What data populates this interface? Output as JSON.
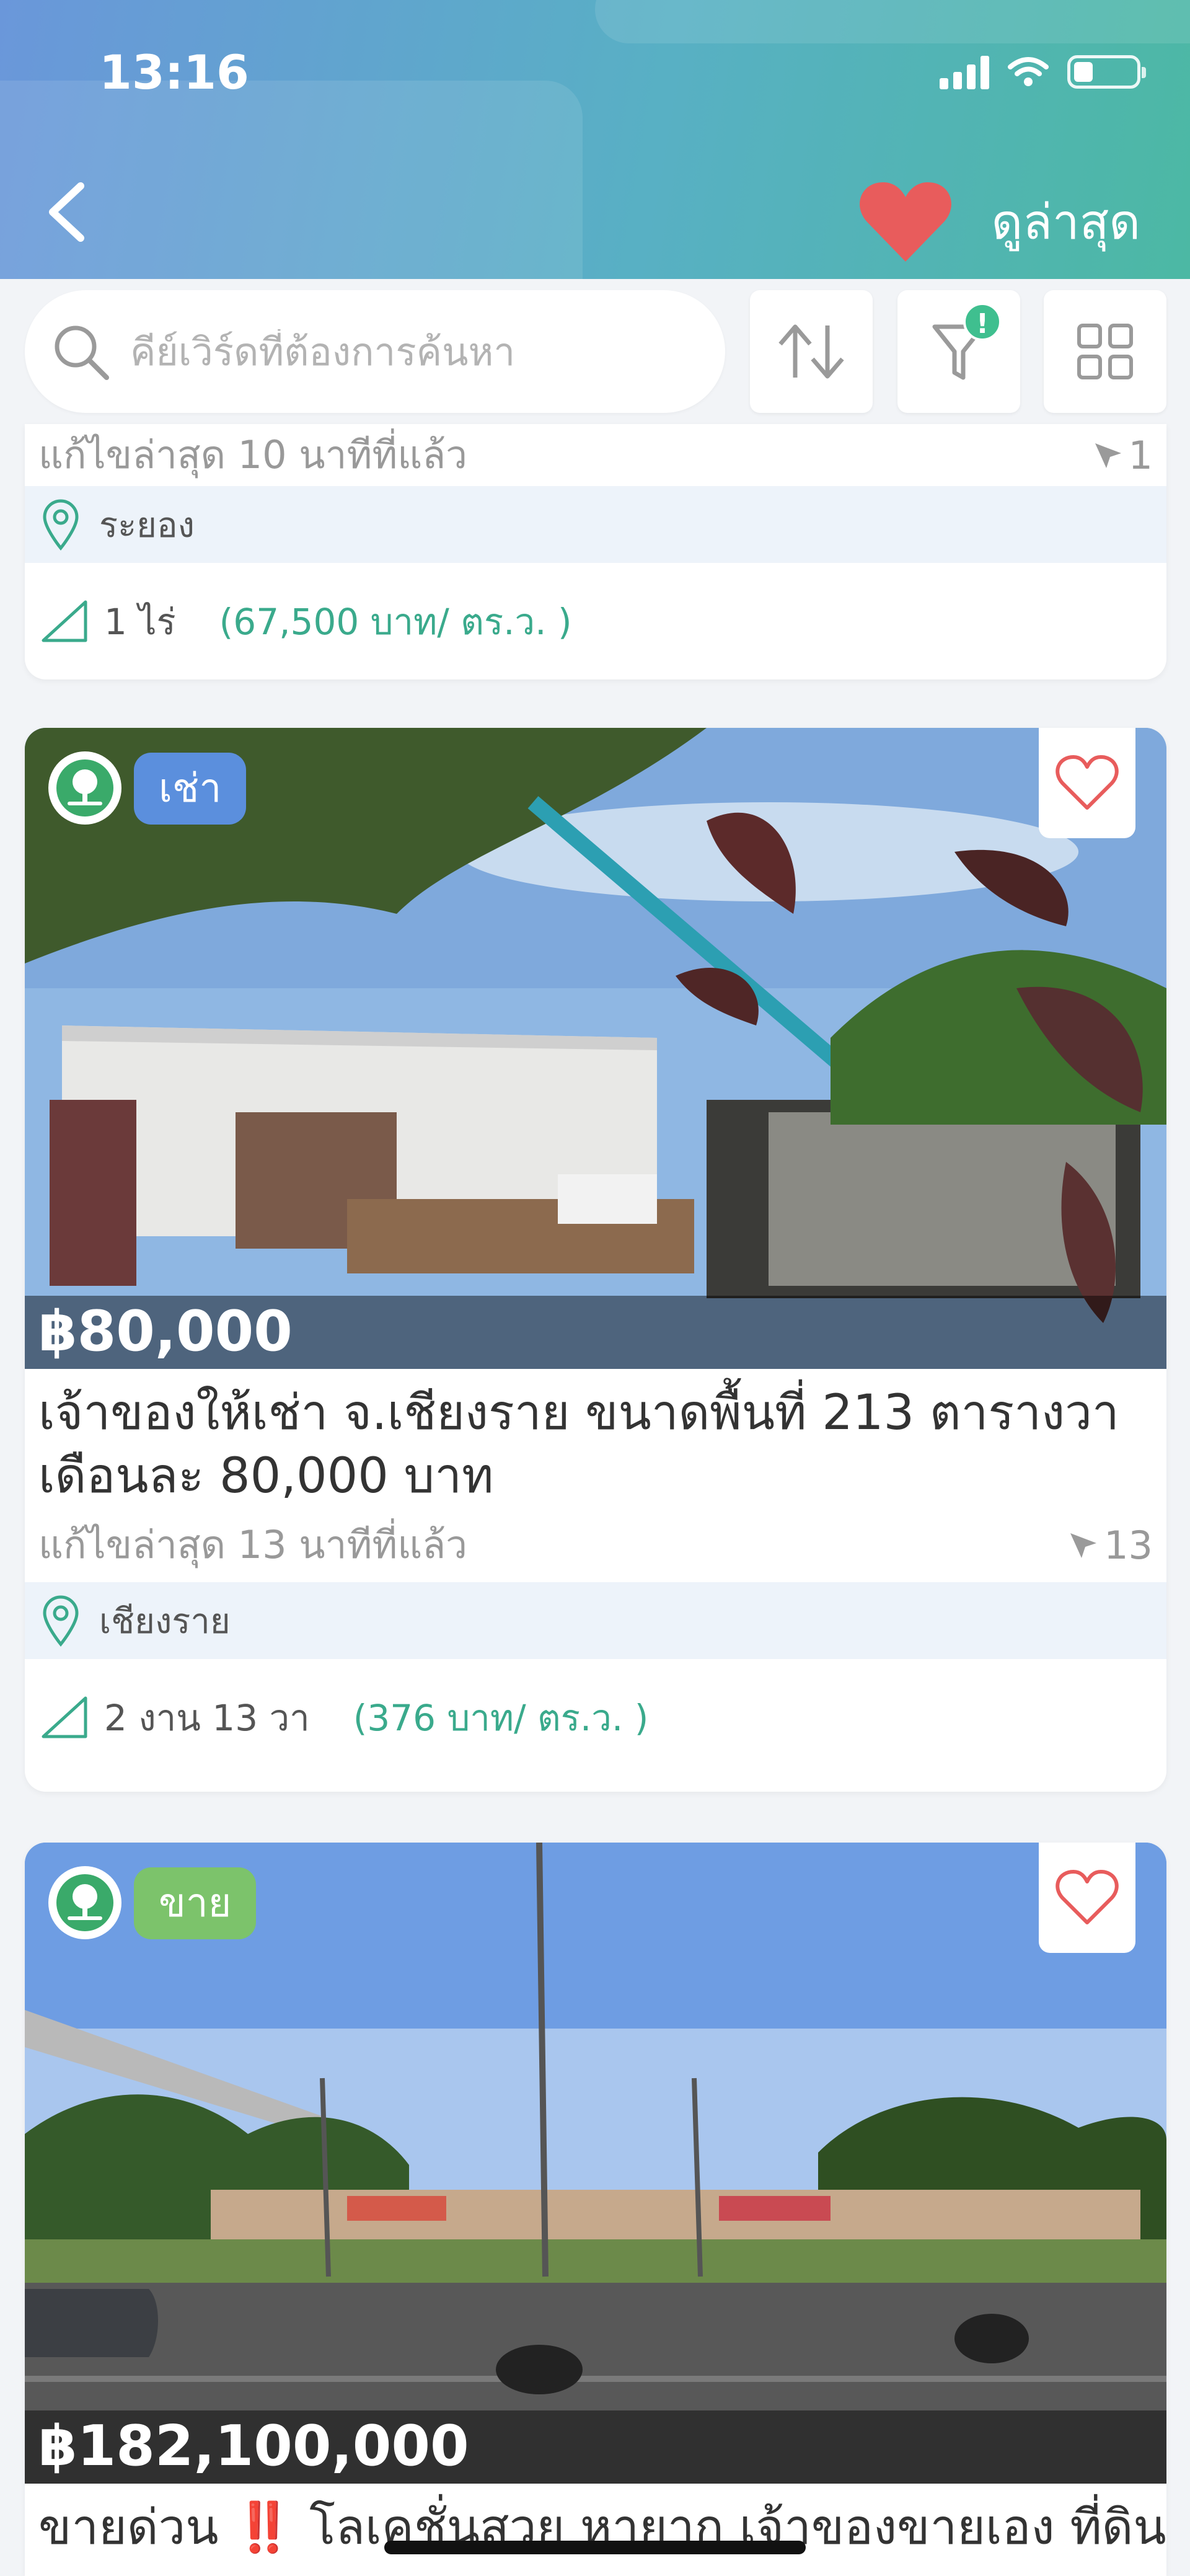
{
  "status_bar": {
    "time": "13:16"
  },
  "header": {
    "latest_label": "ดูล่าสุด"
  },
  "toolbar": {
    "search_placeholder": "คีย์เวิร์ดที่ต้องการค้นหา",
    "filter_badge": "!"
  },
  "listings": [
    {
      "updated": "แก้ไขล่าสุด 10 นาทีที่แล้ว",
      "views": "1",
      "location": "ระยอง",
      "area": "1 ไร่",
      "price_per_wa": "(67,500 บาท/ ตร.ว. )"
    },
    {
      "type": "เช่า",
      "type_color": "#5b8fdd",
      "price": "฿80,000",
      "title": "เจ้าของให้เช่า จ.เชียงราย ขนาดพื้นที่ 213 ตารางวา เดือนละ 80,000 บาท",
      "updated": "แก้ไขล่าสุด 13 นาทีที่แล้ว",
      "views": "13",
      "location": "เชียงราย",
      "area": "2 งาน  13 วา",
      "price_per_wa": "(376 บาท/ ตร.ว. )"
    },
    {
      "type": "ขาย",
      "type_color": "#7cc36b",
      "price": "฿182,100,000",
      "title": "ขายด่วน ‼️ โลเคชั่นสวย หายาก เจ้าของขายเอง ที่ดิน"
    }
  ],
  "colors": {
    "accent": "#3aaa8c",
    "heart": "#e85c5c",
    "header_start": "#6a97da",
    "header_end": "#4cb8a4"
  }
}
